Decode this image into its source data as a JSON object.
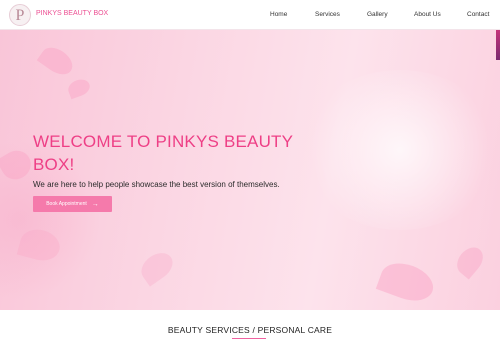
{
  "header": {
    "logo_letter": "P",
    "brand": "PINKYS BEAUTY BOX",
    "nav": [
      {
        "label": "Home"
      },
      {
        "label": "Services"
      },
      {
        "label": "Gallery"
      },
      {
        "label": "About Us"
      },
      {
        "label": "Contact"
      }
    ]
  },
  "hero": {
    "title": "WELCOME TO PINKYS BEAUTY BOX!",
    "subtitle": "We are here to help people showcase the best version of themselves.",
    "cta_label": "Book Appointment",
    "cta_icon": "arrow-right-icon"
  },
  "section": {
    "title": "BEAUTY SERVICES / PERSONAL CARE"
  },
  "colors": {
    "brand_pink": "#ec4f92",
    "button_pink": "#f57aab",
    "hero_background": "#fbd6e3"
  }
}
